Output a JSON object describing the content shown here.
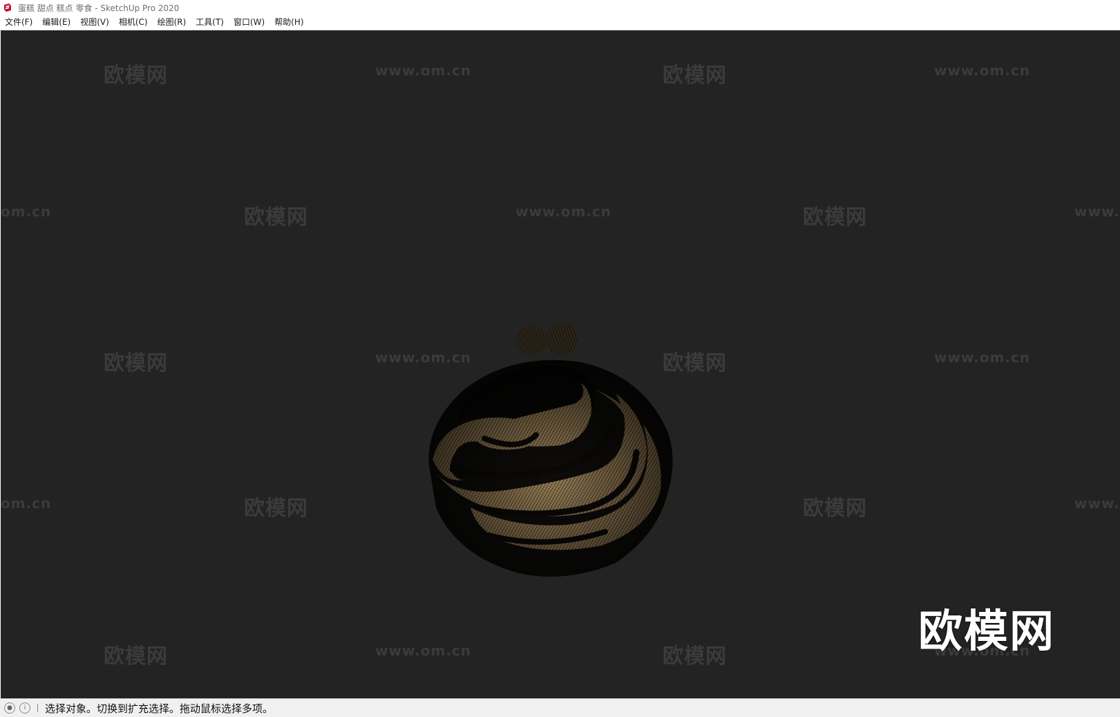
{
  "window": {
    "title": "蛋糕 甜点 糕点 零食 - SketchUp Pro 2020",
    "app_icon": "sketchup-icon"
  },
  "menu": {
    "items": [
      "文件(F)",
      "编辑(E)",
      "视图(V)",
      "相机(C)",
      "绘图(R)",
      "工具(T)",
      "窗口(W)",
      "帮助(H)"
    ]
  },
  "viewport": {
    "background": "#232323",
    "watermark_cn": "欧模网",
    "watermark_url": "www.om.cn",
    "watermark_partial_left": "om.cn",
    "watermark_partial_right": "www.",
    "watermark_big": "欧模网"
  },
  "status": {
    "geo_icon": "geolocation-icon",
    "info_icon": "info-icon",
    "message": "选择对象。切换到扩充选择。拖动鼠标选择多项。"
  }
}
